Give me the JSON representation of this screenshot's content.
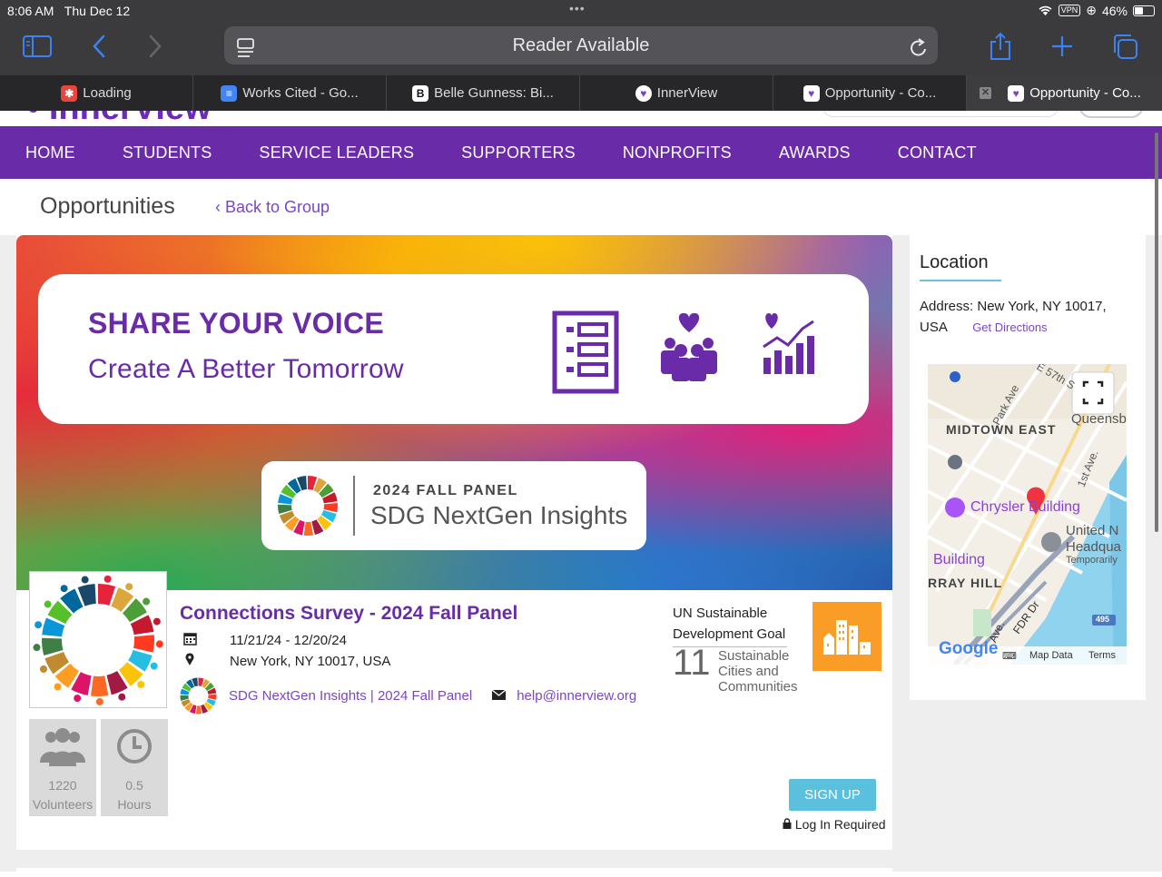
{
  "status": {
    "time": "8:06 AM",
    "date": "Thu Dec 12",
    "vpn": "VPN",
    "battery": "46%",
    "battery_level": 0.46
  },
  "browser": {
    "address_text": "Reader Available",
    "tabs": [
      {
        "label": "Loading",
        "favicon": "pinwheel-icon",
        "color": "#e8453c"
      },
      {
        "label": "Works Cited - Go...",
        "favicon": "docs-icon",
        "color": "#4285f4"
      },
      {
        "label": "Belle Gunness: Bi...",
        "favicon": "B",
        "color": "#111111"
      },
      {
        "label": "InnerView",
        "favicon": "innerview-icon",
        "color": "#7b45c8"
      },
      {
        "label": "Opportunity - Co...",
        "favicon": "innerview-icon",
        "color": "#7b45c8"
      },
      {
        "label": "Opportunity - Co...",
        "favicon": "innerview-icon",
        "color": "#7b45c8"
      }
    ]
  },
  "nav": {
    "items": [
      "HOME",
      "STUDENTS",
      "SERVICE LEADERS",
      "SUPPORTERS",
      "NONPROFITS",
      "AWARDS",
      "CONTACT"
    ]
  },
  "page": {
    "title": "Opportunities",
    "back_link": "‹ Back to Group"
  },
  "banner": {
    "headline": "SHARE YOUR VOICE",
    "subheadline": "Create A Better Tomorrow",
    "panel_label": "2024 FALL PANEL",
    "panel_name": "SDG NextGen Insights"
  },
  "opportunity": {
    "title": "Connections Survey - 2024 Fall Panel",
    "dates": "11/21/24 - 12/20/24",
    "location": "New York, NY 10017, USA",
    "group_link": "SDG NextGen Insights | 2024 Fall Panel",
    "email": "help@innerview.org",
    "stats": [
      {
        "value": "1220",
        "label": "Volunteers",
        "icon": "people-icon"
      },
      {
        "value": "0.5",
        "label": "Hours",
        "icon": "clock-icon"
      }
    ],
    "sdg": {
      "heading_line1": "UN Sustainable",
      "heading_line2": "Development Goal",
      "number": "11",
      "name_line1": "Sustainable",
      "name_line2": "Cities and",
      "name_line3": "Communities",
      "color": "#f99d26"
    },
    "signup_label": "SIGN UP",
    "login_note": "Log In Required"
  },
  "location": {
    "heading": "Location",
    "address": "Address: New York, NY 10017, USA",
    "directions": "Get Directions",
    "map": {
      "labels": [
        "Park Ave",
        "E 57th S",
        "Queensb",
        "MIDTOWN EAST",
        "1st Ave.",
        "Chrysler Building",
        "United N",
        "Headqua",
        "Temporarily",
        "Building",
        "RRAY HILL",
        "FDR Dr",
        "Ave.",
        "495"
      ],
      "footer_data": "Map Data",
      "footer_terms": "Terms",
      "brand": "Google"
    }
  },
  "colors": {
    "brand_purple": "#6a2ba8",
    "link_purple": "#7b45c8",
    "signup_blue": "#5bc0de"
  }
}
